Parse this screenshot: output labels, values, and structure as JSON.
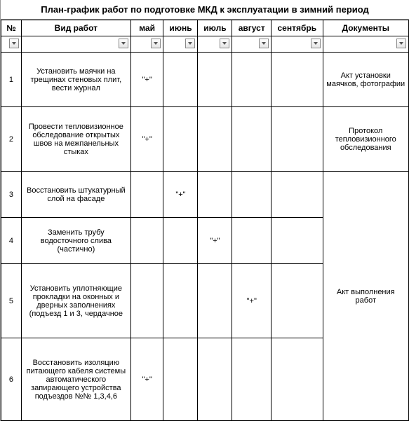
{
  "chart_data": {
    "type": "table",
    "title": "План-график работ по подготовке МКД к эксплуатации в зимний период",
    "columns": [
      "№",
      "Вид работ",
      "май",
      "июнь",
      "июль",
      "август",
      "сентябрь",
      "Документы"
    ],
    "rows": [
      {
        "num": "1",
        "work": "Установить маячки на трещинах стеновых плит, вести журнал",
        "may": "\"+\"",
        "jun": "",
        "jul": "",
        "aug": "",
        "sep": "",
        "doc": "Акт установки маячков, фотографии"
      },
      {
        "num": "2",
        "work": "Провести тепловизионное обследование открытых швов на межпанельных стыках",
        "may": "\"+\"",
        "jun": "",
        "jul": "",
        "aug": "",
        "sep": "",
        "doc": "Протокол тепловизионного обследования"
      },
      {
        "num": "3",
        "work": "Восстановить штукатурный слой на фасаде",
        "may": "",
        "jun": "\"+\"",
        "jul": "",
        "aug": "",
        "sep": "",
        "doc": ""
      },
      {
        "num": "4",
        "work": "Заменить трубу водосточного слива (частично)",
        "may": "",
        "jun": "",
        "jul": "\"+\"",
        "aug": "",
        "sep": "",
        "doc": ""
      },
      {
        "num": "5",
        "work": "Установить уплотняющие прокладки на оконных и дверных заполнениях (подъезд 1 и 3, чердачное",
        "may": "",
        "jun": "",
        "jul": "",
        "aug": "\"+\"",
        "sep": "",
        "doc": ""
      },
      {
        "num": "6",
        "work": "Восстановить изоляцию питающего кабеля системы автоматического запирающего устройства подъездов №№ 1,3,4,6",
        "may": "\"+\"",
        "jun": "",
        "jul": "",
        "aug": "",
        "sep": "",
        "doc": "Акт выполнения работ"
      }
    ]
  },
  "title": "План-график работ по подготовке МКД к эксплуатации в зимний период",
  "headers": {
    "num": "№",
    "work": "Вид работ",
    "may": "май",
    "jun": "июнь",
    "jul": "июль",
    "aug": "август",
    "sep": "сентябрь",
    "doc": "Документы"
  },
  "rows": {
    "r1": {
      "num": "1",
      "work": "Установить маячки на трещинах стеновых плит, вести журнал",
      "may": "\"+\"",
      "jun": "",
      "jul": "",
      "aug": "",
      "sep": "",
      "doc": "Акт установки маячков, фотографии"
    },
    "r2": {
      "num": "2",
      "work": "Провести тепловизионное обследование открытых швов на межпанельных стыках",
      "may": "\"+\"",
      "jun": "",
      "jul": "",
      "aug": "",
      "sep": "",
      "doc": "Протокол тепловизионного обследования"
    },
    "r3": {
      "num": "3",
      "work": "Восстановить штукатурный слой на фасаде",
      "may": "",
      "jun": "\"+\"",
      "jul": "",
      "aug": "",
      "sep": ""
    },
    "r4": {
      "num": "4",
      "work": "Заменить трубу водосточного слива (частично)",
      "may": "",
      "jun": "",
      "jul": "\"+\"",
      "aug": "",
      "sep": ""
    },
    "r5": {
      "num": "5",
      "work": "Установить уплотняющие прокладки на оконных и дверных заполнениях (подъезд 1 и 3, чердачное",
      "may": "",
      "jun": "",
      "jul": "",
      "aug": "\"+\"",
      "sep": ""
    },
    "r6": {
      "num": "6",
      "work": "Восстановить изоляцию питающего кабеля системы автоматического запирающего устройства подъездов №№ 1,3,4,6",
      "may": "\"+\"",
      "jun": "",
      "jul": "",
      "aug": "",
      "sep": "",
      "doc": "Акт выполнения работ"
    }
  }
}
